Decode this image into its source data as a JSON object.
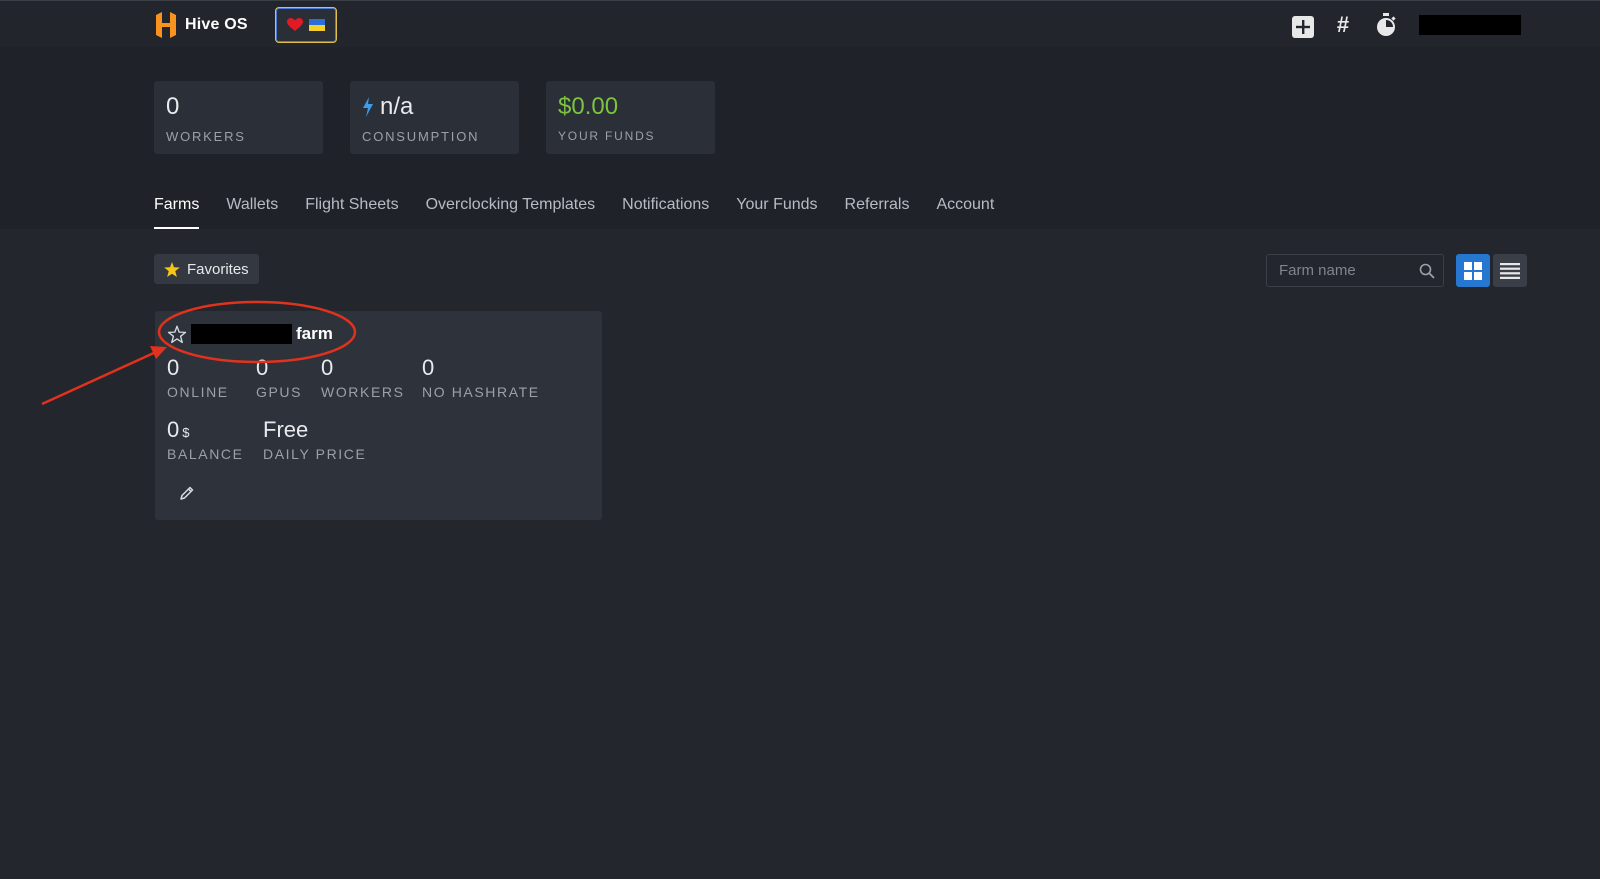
{
  "app": {
    "name": "Hive OS"
  },
  "stats": [
    {
      "value": "0",
      "label": "WORKERS"
    },
    {
      "value": "n/a",
      "label": "CONSUMPTION"
    },
    {
      "value": "$0.00",
      "label": "YOUR FUNDS"
    }
  ],
  "tabs": [
    {
      "label": "Farms",
      "active": true
    },
    {
      "label": "Wallets"
    },
    {
      "label": "Flight Sheets"
    },
    {
      "label": "Overclocking Templates"
    },
    {
      "label": "Notifications"
    },
    {
      "label": "Your Funds"
    },
    {
      "label": "Referrals"
    },
    {
      "label": "Account"
    }
  ],
  "toolbar": {
    "favorites_label": "Favorites",
    "search_placeholder": "Farm name"
  },
  "farm": {
    "name_suffix": "farm",
    "metrics": {
      "online": {
        "value": "0",
        "label": "ONLINE"
      },
      "gpus": {
        "value": "0",
        "label": "GPUS"
      },
      "workers": {
        "value": "0",
        "label": "WORKERS"
      },
      "hashrate": {
        "value": "0",
        "label": "NO HASHRATE"
      },
      "balance": {
        "value": "0",
        "unit": "$",
        "label": "BALANCE"
      },
      "daily_price": {
        "value": "Free",
        "label": "DAILY PRICE"
      }
    }
  },
  "colors": {
    "accent": "#2577cf",
    "funds_green": "#7cc340",
    "logo_orange": "#f7931e",
    "annotation_red": "#e0321c"
  },
  "icons": {
    "top_right": [
      "plus-square-icon",
      "hash-icon",
      "stopwatch-icon"
    ],
    "support": [
      "heart-icon",
      "ukraine-flag-icon"
    ]
  }
}
